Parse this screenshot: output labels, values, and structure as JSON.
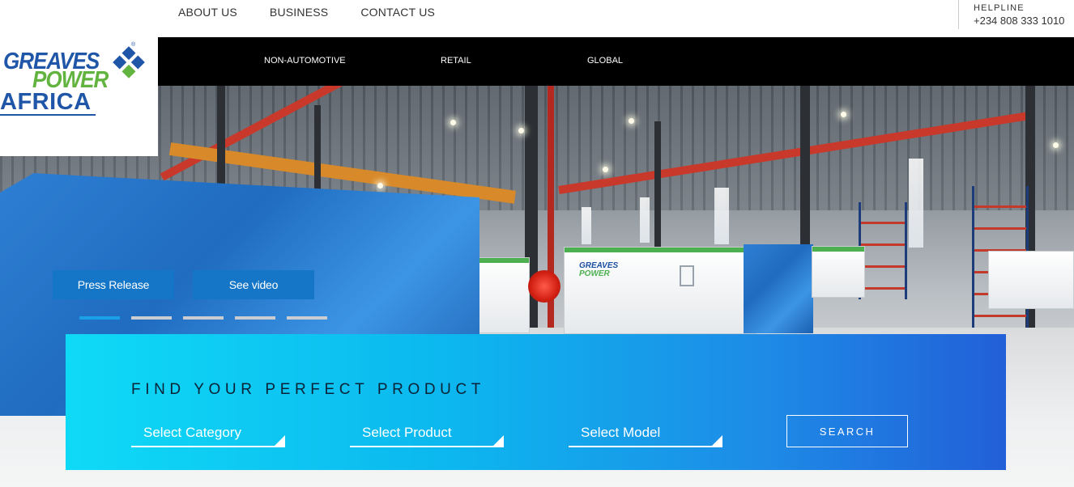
{
  "top_nav": {
    "items": [
      "ABOUT US",
      "BUSINESS",
      "CONTACT US"
    ]
  },
  "helpline": {
    "label": "HELPLINE",
    "number": "+234 808 333 1010"
  },
  "logo": {
    "line1": "GREAVES",
    "line2": "POWER",
    "line3": "AFRICA",
    "registered": "®",
    "mark_icon": "diamond-tiles-icon"
  },
  "main_nav": {
    "items": [
      "NON-AUTOMOTIVE",
      "RETAIL",
      "GLOBAL"
    ]
  },
  "hero": {
    "buttons": [
      "Press Release",
      "See video"
    ],
    "slides_total": 5,
    "active_slide": 1,
    "genset_brand_line1": "GREAVES",
    "genset_brand_line2": "POWER"
  },
  "finder": {
    "title": "FIND YOUR PERFECT PRODUCT",
    "category_value": "Select Category",
    "product_value": "Select Product",
    "model_value": "Select Model",
    "search_label": "SEARCH"
  },
  "colors": {
    "brand_blue": "#1f56a8",
    "brand_green": "#63b340",
    "button_blue": "#1576c7",
    "finder_start": "#0fdaf6",
    "finder_end": "#225fd8",
    "nav_black": "#000000"
  }
}
